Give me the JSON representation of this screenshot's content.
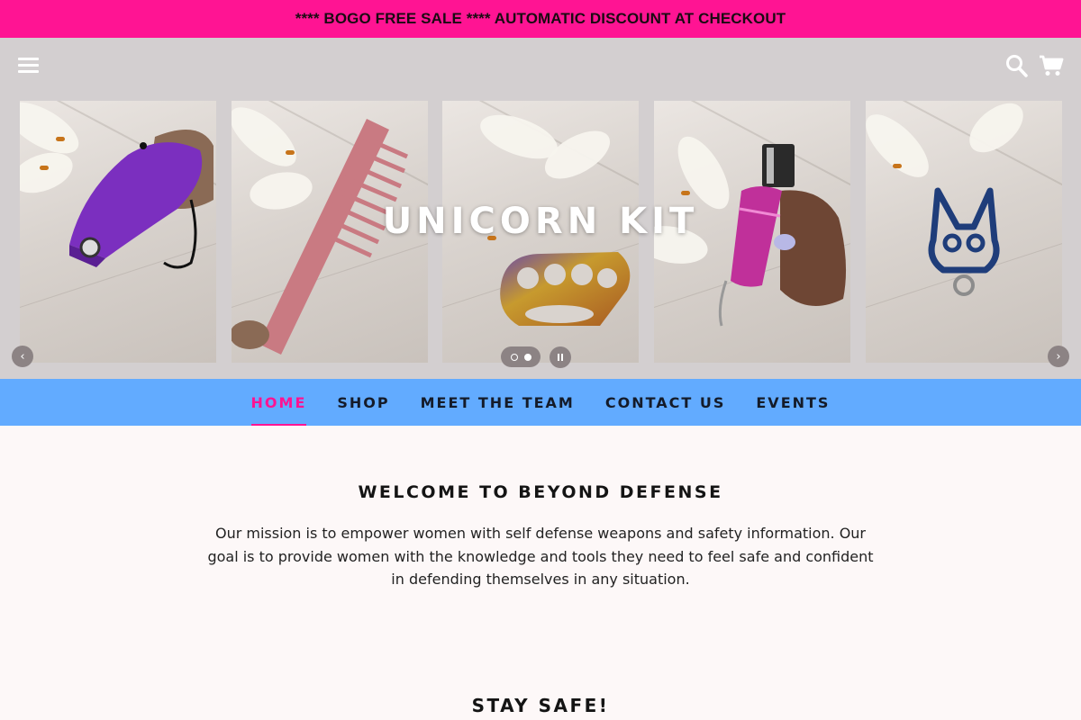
{
  "announcement": {
    "text": "**** BOGO FREE SALE **** AUTOMATIC DISCOUNT AT CHECKOUT"
  },
  "header": {
    "menu_icon": "hamburger-menu-icon",
    "search_icon": "search-icon",
    "cart_icon": "cart-icon"
  },
  "slideshow": {
    "title": "UNICORN KIT",
    "slides": [
      {
        "item": "purple stun gun flashlight",
        "color": "#7b2fbf"
      },
      {
        "item": "pink comb knife",
        "color": "#c97a82"
      },
      {
        "item": "rainbow brass knuckles",
        "color": "#c79a2e"
      },
      {
        "item": "pink rhinestone pepper spray",
        "color": "#c0309a"
      },
      {
        "item": "blue cat keychain",
        "color": "#1f3d7a"
      }
    ],
    "prev_icon": "chevron-left-icon",
    "next_icon": "chevron-right-icon",
    "pause_icon": "pause-icon",
    "current_slide": 2,
    "total_slides": 2
  },
  "nav": {
    "items": [
      {
        "label": "HOME",
        "active": true
      },
      {
        "label": "SHOP",
        "active": false
      },
      {
        "label": "MEET THE TEAM",
        "active": false
      },
      {
        "label": "CONTACT US",
        "active": false
      },
      {
        "label": "EVENTS",
        "active": false
      }
    ]
  },
  "welcome": {
    "title": "WELCOME TO BEYOND DEFENSE",
    "body": "Our mission is to empower women with self defense weapons and safety information. Our goal is to provide women with the knowledge and tools they need to feel safe and confident in defending themselves in any situation."
  },
  "stay_safe": {
    "title": "STAY SAFE!"
  },
  "colors": {
    "announcement_bg": "#ff1493",
    "header_bg": "#d3cfd0",
    "nav_bg": "#62abff",
    "nav_active": "#ff1493",
    "page_bg": "#fdf8f8"
  }
}
